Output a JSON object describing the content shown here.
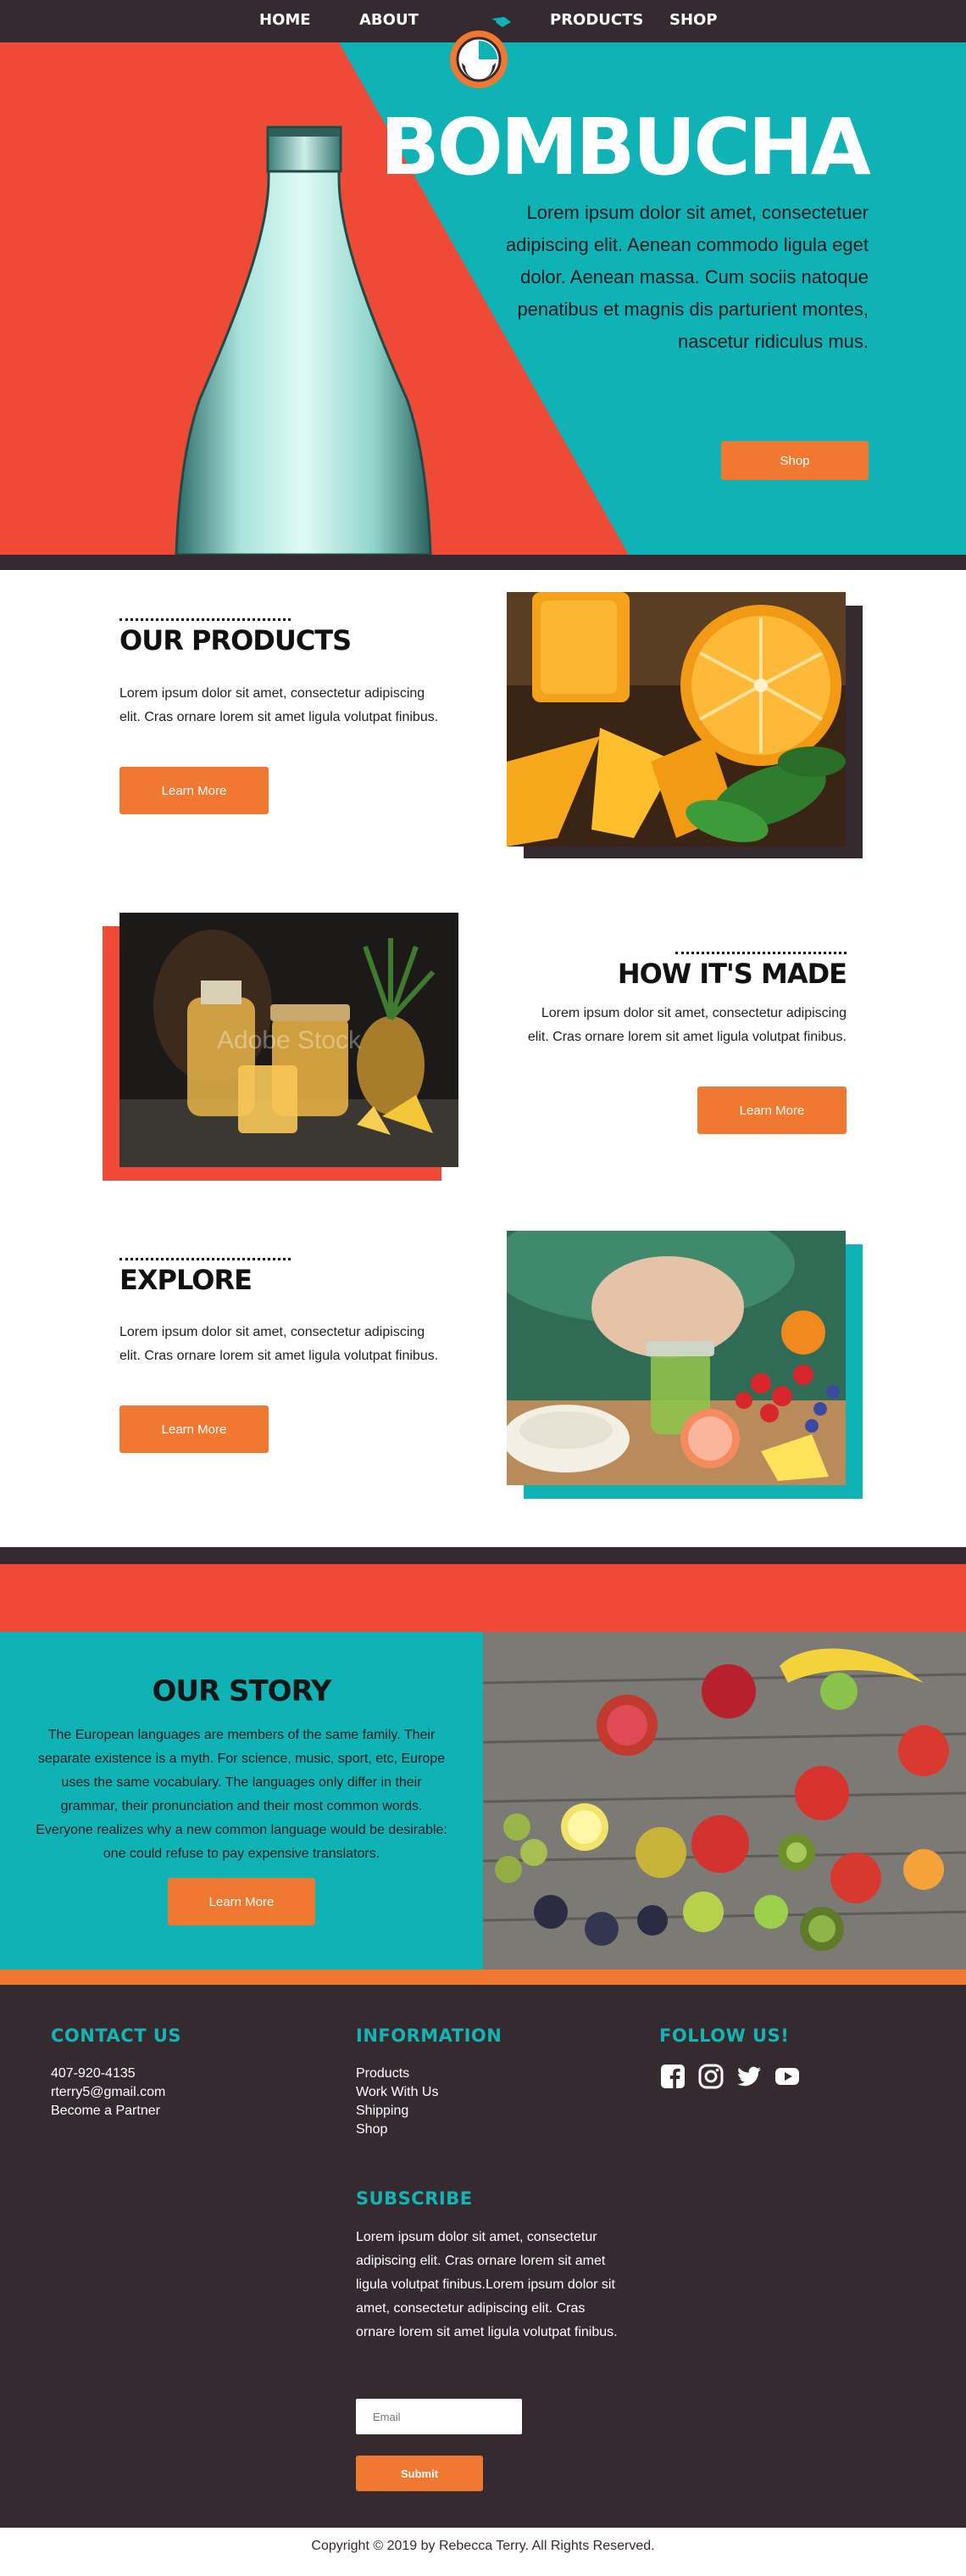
{
  "nav": {
    "items": [
      "HOME",
      "ABOUT",
      "PRODUCTS",
      "SHOP"
    ]
  },
  "hero": {
    "title": "BOMBUCHA",
    "text": "Lorem ipsum dolor sit amet, consectetuer adipiscing elit. Aenean commodo ligula eget dolor. Aenean massa. Cum sociis natoque penatibus et magnis dis parturient montes, nascetur ridiculus mus.",
    "button": "Shop"
  },
  "features": [
    {
      "title": "OUR PRODUCTS",
      "text": "Lorem ipsum dolor sit amet, consectetur adipiscing elit. Cras ornare lorem sit amet ligula volutpat finibus.",
      "button": "Learn More",
      "image": "oranges-and-juice",
      "accent": "#352a30"
    },
    {
      "title": "HOW IT'S MADE",
      "text": "Lorem ipsum dolor sit amet, consectetur adipiscing elit. Cras ornare lorem sit amet ligula volutpat finibus.",
      "button": "Learn More",
      "image": "pineapple-juice-jars",
      "watermark": "Adobe Stock",
      "accent": "#ee4a35"
    },
    {
      "title": "EXPLORE",
      "text": "Lorem ipsum dolor sit amet, consectetur adipiscing elit. Cras ornare lorem sit amet ligula volutpat finibus.",
      "button": "Learn More",
      "image": "fruit-bowl-and-drink",
      "accent": "#0fb3b5"
    }
  ],
  "story": {
    "title": "OUR STORY",
    "text": "The European languages are members of the same family. Their separate existence is a myth. For science, music, sport, etc, Europe uses the same vocabulary. The languages only differ in their grammar, their pronunciation and their most common words. Everyone realizes why a new common language would be desirable: one could refuse to pay expensive translators.",
    "button": "Learn More",
    "image": "fruits-on-wooden-table"
  },
  "footer": {
    "contact": {
      "title": "CONTACT US",
      "lines": [
        "407-920-4135",
        "rterry5@gmail.com",
        "Become a Partner"
      ]
    },
    "information": {
      "title": "INFORMATION",
      "links": [
        "Products",
        "Work With Us",
        "Shipping",
        "Shop"
      ]
    },
    "follow": {
      "title": "FOLLOW US!",
      "icons": [
        "facebook-icon",
        "instagram-icon",
        "twitter-icon",
        "youtube-icon"
      ]
    },
    "subscribe": {
      "title": "SUBSCRIBE",
      "text": "Lorem ipsum dolor sit amet, consectetur adipiscing elit. Cras ornare lorem sit amet ligula volutpat finibus.Lorem ipsum dolor sit amet, consectetur adipiscing elit. Cras ornare lorem sit amet ligula volutpat finibus.",
      "placeholder": "Email",
      "button": "Submit"
    }
  },
  "copyright": "Copyright © 2019 by Rebecca Terry. All Rights Reserved.",
  "colors": {
    "dark": "#352a30",
    "teal": "#0fb3b5",
    "red": "#ee4a35",
    "orange": "#f07830"
  }
}
